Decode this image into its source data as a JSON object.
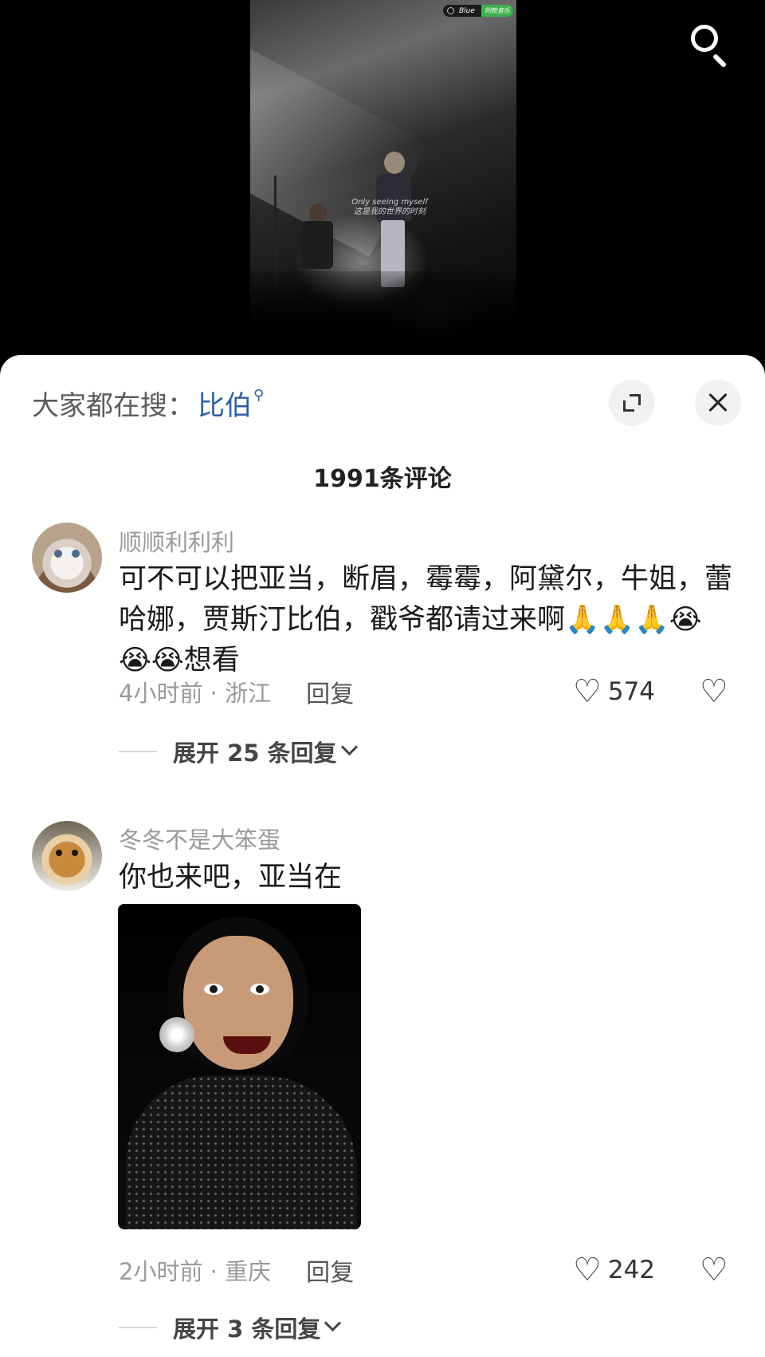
{
  "video": {
    "music_title": "Blue",
    "music_tag": "同款音乐",
    "caption_line1": "Only seeing myself",
    "caption_line2": "这是我的世界的时刻"
  },
  "search_bar": {
    "prefix": "大家都在搜：",
    "term": "比伯"
  },
  "comment_count": "1991条评论",
  "comments": [
    {
      "username": "顺顺利利利",
      "text": "可不可以把亚当，断眉，霉霉，阿黛尔，牛姐，蕾哈娜，贾斯汀比伯，戳爷都请过来啊🙏🙏🙏😭😭😭想看",
      "time_location": "4小时前 · 浙江",
      "reply_label": "回复",
      "likes": "574",
      "expand_label": "展开 25 条回复"
    },
    {
      "username": "冬冬不是大笨蛋",
      "text": "你也来吧，亚当在",
      "time_location": "2小时前 · 重庆",
      "reply_label": "回复",
      "likes": "242",
      "expand_label": "展开 3 条回复"
    }
  ],
  "icons": {
    "top_search": "search-icon",
    "expand": "expand-icon",
    "close": "close-icon",
    "like": "heart-icon",
    "dislike": "broken-heart-icon"
  },
  "colors": {
    "search_term": "#2d5fa8",
    "music_tag": "#3db34a"
  }
}
